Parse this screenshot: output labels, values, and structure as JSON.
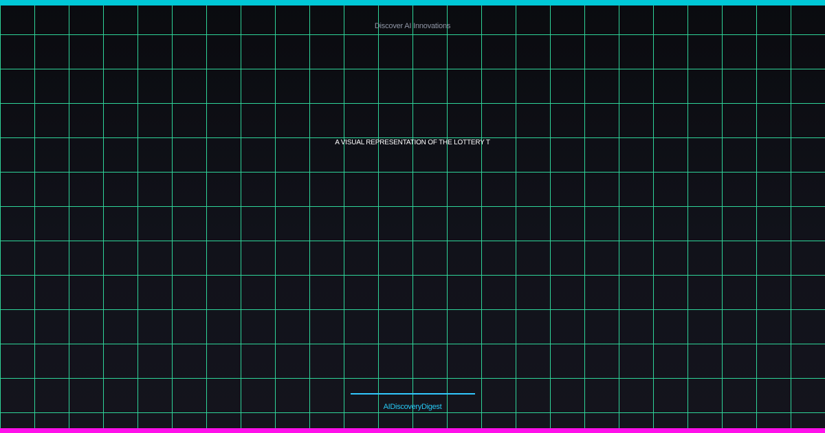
{
  "header": {
    "kicker": "Discover AI Innovations"
  },
  "main": {
    "headline": "A VISUAL REPRESENTATION OF THE LOTTERY T"
  },
  "footer": {
    "brand": "AIDiscoveryDigest"
  },
  "theme": {
    "background": "#0b0c11",
    "grid_color": "#2fd69a",
    "top_accent": "#00c8d7",
    "bottom_accent": "#ff10ea",
    "brand_color": "#27c7f2"
  }
}
